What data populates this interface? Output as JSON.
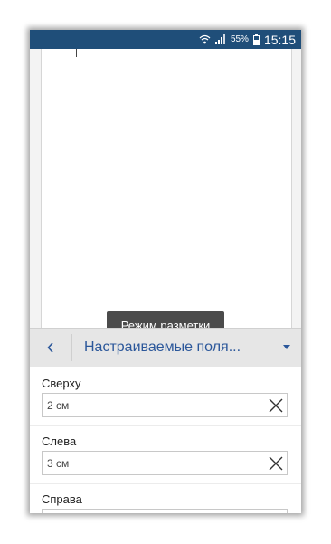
{
  "status_bar": {
    "battery_percent": "55%",
    "time": "15:15"
  },
  "document": {
    "toast": "Режим разметки"
  },
  "panel": {
    "title": "Настраиваемые поля...",
    "back_icon": "chevron-left-icon",
    "dropdown_icon": "caret-down-icon"
  },
  "fields": [
    {
      "label": "Сверху",
      "value": "2 см"
    },
    {
      "label": "Слева",
      "value": "3 см"
    },
    {
      "label": "Справа",
      "value": ""
    }
  ],
  "colors": {
    "status_bar": "#1f4e79",
    "accent": "#2b579a",
    "toast_bg": "#4b4b4b"
  }
}
